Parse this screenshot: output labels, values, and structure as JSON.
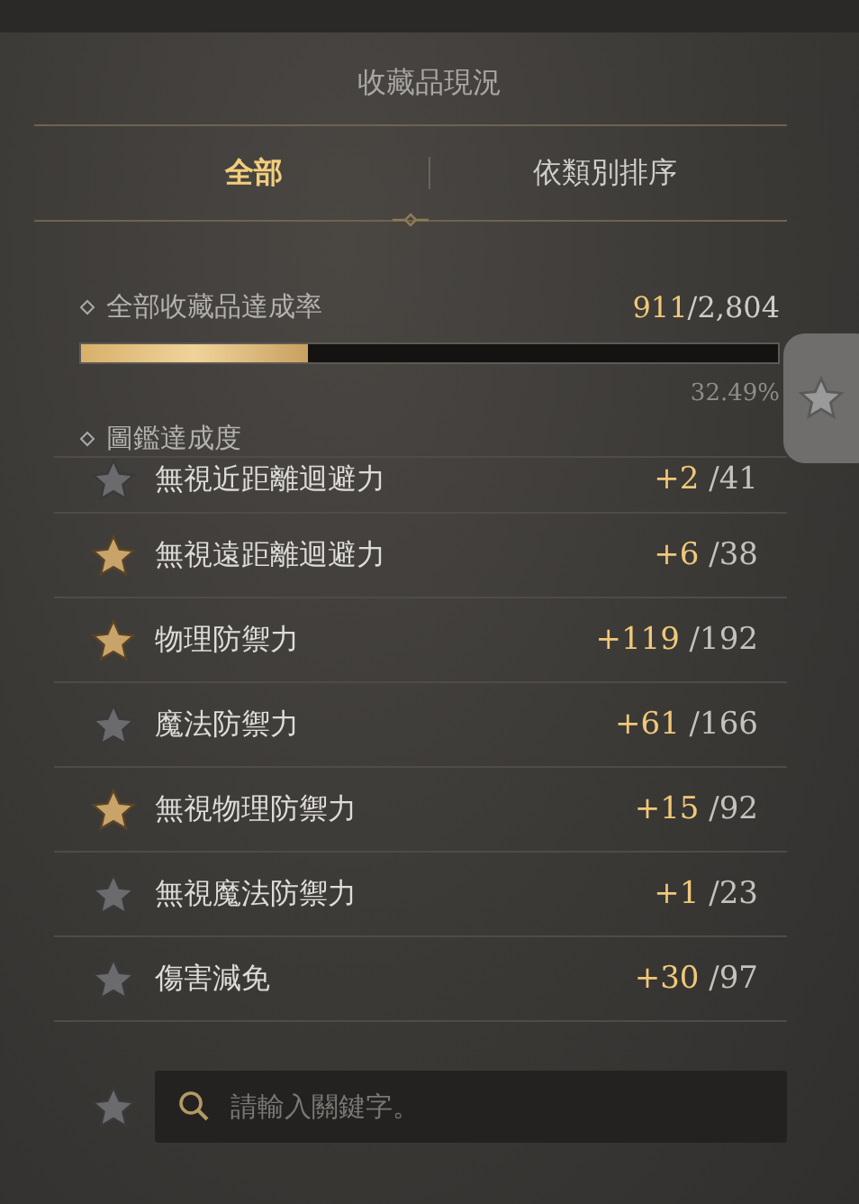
{
  "title": "收藏品現況",
  "tabs": [
    {
      "label": "全部",
      "selected": true
    },
    {
      "label": "依類別排序",
      "selected": false
    }
  ],
  "overall": {
    "label": "全部收藏品達成率",
    "count": "911",
    "total": "/2,804",
    "level": 0.3249,
    "percent": "32.49%"
  },
  "codex": {
    "label": "圖鑑達成度"
  },
  "rows": [
    {
      "name": "無視近距離迴避力",
      "gain": "+2",
      "total": "/41",
      "starred": false
    },
    {
      "name": "無視遠距離迴避力",
      "gain": "+6",
      "total": "/38",
      "starred": true
    },
    {
      "name": "物理防禦力",
      "gain": "+119",
      "total": "/192",
      "starred": true
    },
    {
      "name": "魔法防禦力",
      "gain": "+61",
      "total": "/166",
      "starred": false
    },
    {
      "name": "無視物理防禦力",
      "gain": "+15",
      "total": "/92",
      "starred": true
    },
    {
      "name": "無視魔法防禦力",
      "gain": "+1",
      "total": "/23",
      "starred": false
    },
    {
      "name": "傷害減免",
      "gain": "+30",
      "total": "/97",
      "starred": false
    }
  ],
  "search": {
    "placeholder": "請輸入關鍵字。"
  }
}
